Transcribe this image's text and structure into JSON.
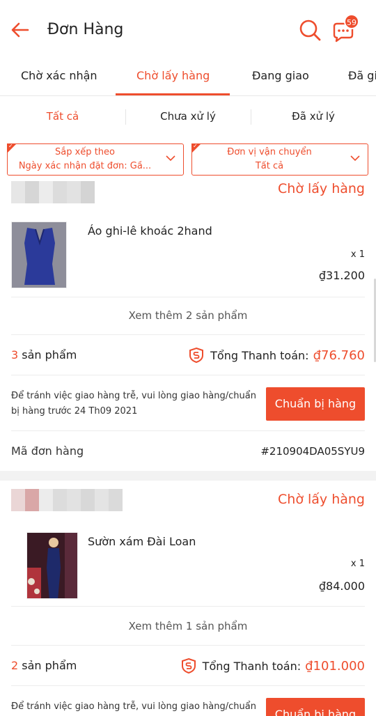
{
  "header": {
    "title": "Đơn Hàng",
    "chat_badge": "59",
    "back_icon": "arrow-left-icon",
    "search_icon": "search-icon",
    "chat_icon": "chat-icon",
    "accent": "#ee4d2d"
  },
  "tabs": [
    {
      "label": "Chờ xác nhận",
      "active": false
    },
    {
      "label": "Chờ lấy hàng",
      "active": true
    },
    {
      "label": "Đang giao",
      "active": false
    },
    {
      "label": "Đã gi",
      "active": false
    }
  ],
  "subtabs": [
    {
      "label": "Tất cả",
      "active": true
    },
    {
      "label": "Chưa xử lý",
      "active": false
    },
    {
      "label": "Đã xử lý",
      "active": false
    }
  ],
  "filters": {
    "sort": {
      "title": "Sắp xếp theo",
      "value": "Ngày xác nhận đặt đơn: Gầ..."
    },
    "carrier": {
      "title": "Đơn vị vận chuyển",
      "value": "Tất cả"
    }
  },
  "orders": [
    {
      "status": "Chờ lấy hàng",
      "product_name": "Áo ghi-lê khoác 2hand",
      "qty": "x 1",
      "price": "₫31.200",
      "see_more": "Xem thêm 2 sản phẩm",
      "count_num": "3",
      "count_label": "sản phẩm",
      "total_label": "Tổng Thanh toán:",
      "total_amount": "₫76.760",
      "notice": "Để tránh việc giao hàng trễ, vui lòng giao hàng/chuẩn bị hàng trước 24 Th09 2021",
      "button": "Chuẩn bị hàng",
      "code_label": "Mã đơn hàng",
      "code_value": "#210904DA05SYU9"
    },
    {
      "status": "Chờ lấy hàng",
      "product_name": "Sườn xám Đài Loan",
      "qty": "x 1",
      "price": "₫84.000",
      "see_more": "Xem thêm 1 sản phẩm",
      "count_num": "2",
      "count_label": "sản phẩm",
      "total_label": "Tổng Thanh toán:",
      "total_amount": "₫101.000",
      "notice": "Để tránh việc giao hàng trễ, vui lòng giao hàng/chuẩn",
      "button": "Chuẩn bị hàng"
    }
  ]
}
